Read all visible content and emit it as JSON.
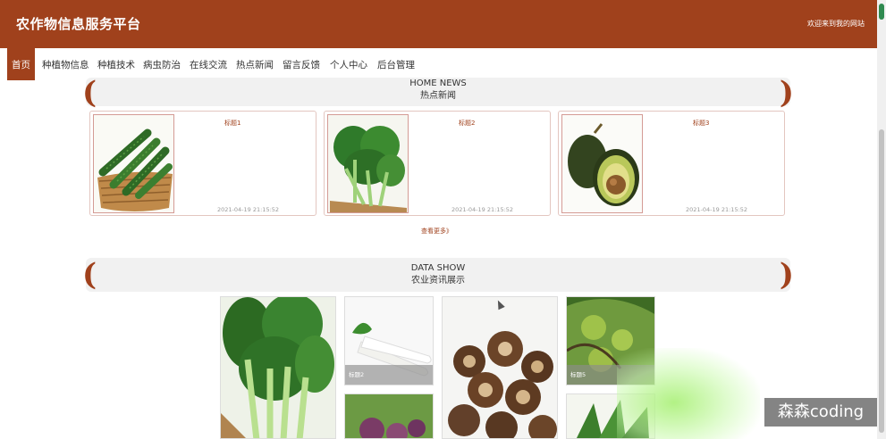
{
  "header": {
    "site_title": "农作物信息服务平台",
    "welcome": "欢迎来到我的网站"
  },
  "nav": {
    "items": [
      {
        "label": "首页",
        "active": true
      },
      {
        "label": "种植物信息"
      },
      {
        "label": "种植技术"
      },
      {
        "label": "病虫防治"
      },
      {
        "label": "在线交流"
      },
      {
        "label": "热点新闻"
      },
      {
        "label": "留言反馈"
      },
      {
        "label": "个人中心"
      },
      {
        "label": "后台管理"
      }
    ]
  },
  "news_section": {
    "title_en": "HOME NEWS",
    "title_cn": "热点新闻",
    "cards": [
      {
        "title": "标题1",
        "date": "2021-04-19 21:15:52",
        "image": "cucumber-basket-photo"
      },
      {
        "title": "标题2",
        "date": "2021-04-19 21:15:52",
        "image": "bok-choy-photo"
      },
      {
        "title": "标题3",
        "date": "2021-04-19 21:15:52",
        "image": "avocado-photo"
      }
    ],
    "more_label": "查看更多》"
  },
  "data_section": {
    "title_en": "DATA SHOW",
    "title_cn": "农业资讯展示",
    "tiles": [
      {
        "caption": "",
        "image": "green-vegetables-photo"
      },
      {
        "caption": "标题2",
        "image": "radish-photo"
      },
      {
        "caption": "",
        "image": "shiitake-mushroom-photo"
      },
      {
        "caption": "标题5",
        "image": "green-fruit-tree-photo"
      },
      {
        "caption": "",
        "image": "plum-photo"
      },
      {
        "caption": "",
        "image": "leafy-greens-photo"
      }
    ]
  },
  "watermark": "森森coding",
  "colors": {
    "brand": "#a0411c",
    "panel": "#f1f1f1"
  }
}
